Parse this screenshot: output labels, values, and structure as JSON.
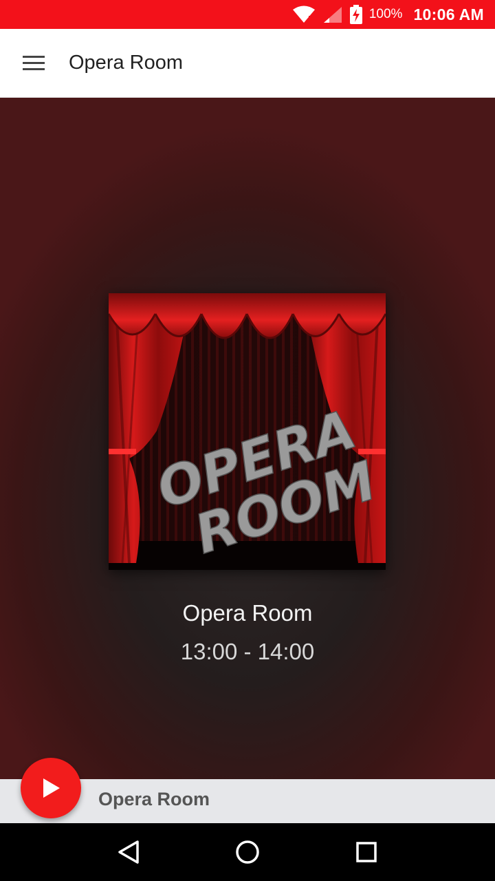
{
  "status_bar": {
    "battery": "100%",
    "time": "10:06 AM",
    "icons": [
      "wifi-icon",
      "signal-icon",
      "battery-charging-icon"
    ]
  },
  "app_bar": {
    "title": "Opera Room",
    "menu_icon": "hamburger-menu-icon"
  },
  "now_playing": {
    "cover_text_line1": "OPERA",
    "cover_text_line2": "ROOM",
    "station_name": "Opera Room",
    "schedule": "13:00 - 14:00"
  },
  "player": {
    "label": "Opera Room",
    "play_icon": "play-icon"
  },
  "nav_bar": {
    "icons": [
      "back-icon",
      "home-icon",
      "recents-icon"
    ]
  },
  "colors": {
    "status_bar": "#f3111a",
    "fab": "#f21c1c",
    "player_bar": "#e6e7ea"
  }
}
